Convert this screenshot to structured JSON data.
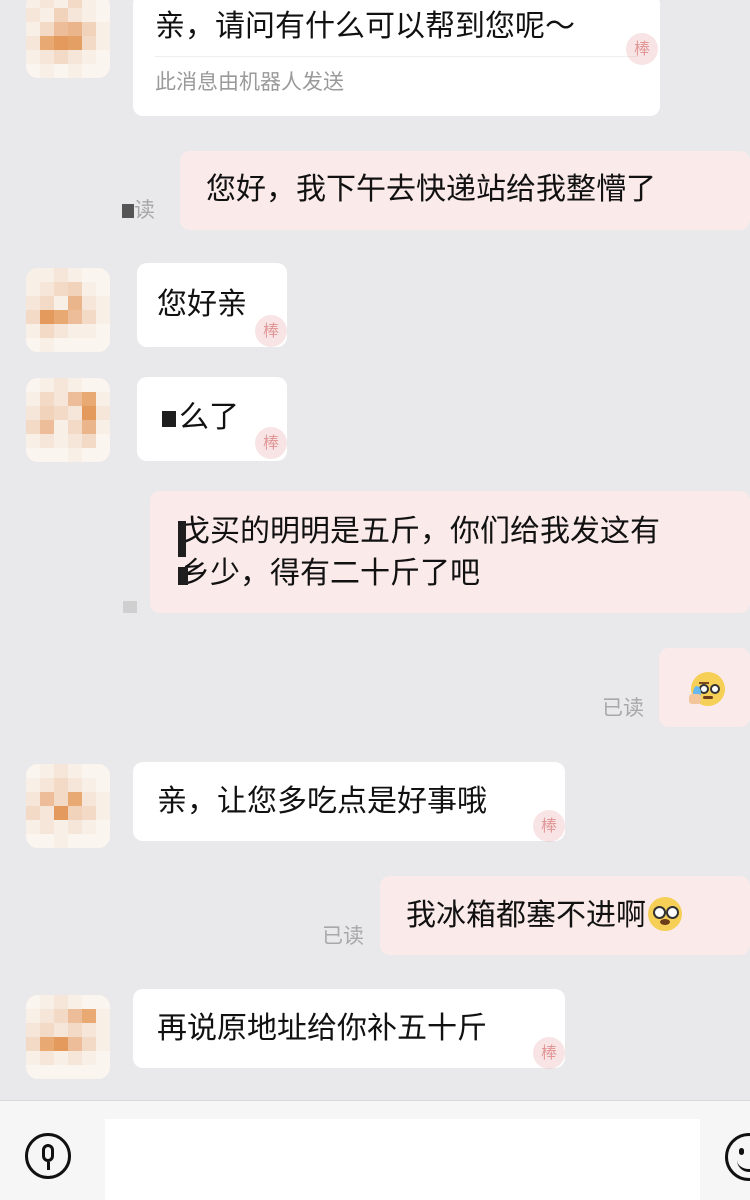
{
  "messages": [
    {
      "side": "left",
      "text": "亲，请问有什么可以帮到您呢～",
      "sub": "此消息由机器人发送",
      "stamp": "棒"
    },
    {
      "side": "right",
      "text": "您好，我下午去快递站给我整懵了",
      "read": "读"
    },
    {
      "side": "left",
      "text": "您好亲",
      "stamp": "棒"
    },
    {
      "side": "left",
      "text": "么了",
      "stamp": "棒"
    },
    {
      "side": "right",
      "lines": [
        "戈买的明明是五斤，你们给我发这有",
        "乡少，得有二十斤了吧"
      ]
    },
    {
      "side": "right",
      "emoji": "tearful-fan-face-emoji",
      "read": "已读"
    },
    {
      "side": "left",
      "text": "亲，让您多吃点是好事哦",
      "stamp": "棒"
    },
    {
      "side": "right",
      "text": "我冰箱都塞不进啊",
      "emoji": "flushed-face-emoji",
      "read": "已读"
    },
    {
      "side": "left",
      "text": "再说原地址给你补五十斤",
      "stamp": "棒"
    }
  ],
  "input_bar": {
    "voice_icon": "microphone-icon",
    "placeholder": "",
    "emoji_icon": "smiley-icon"
  },
  "colors": {
    "background": "#e9e9eb",
    "bubble_left": "#ffffff",
    "bubble_right": "#fbeaea",
    "read_text": "#a8a8a8"
  }
}
